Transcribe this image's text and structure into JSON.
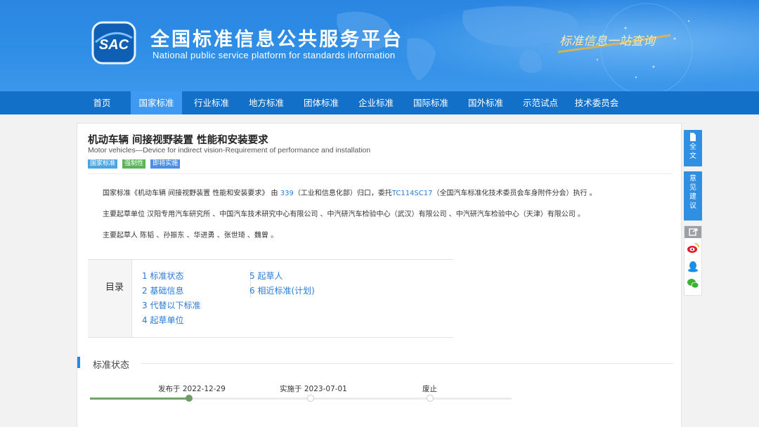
{
  "header": {
    "logo_text": "SAC",
    "title_cn": "全国标准信息公共服务平台",
    "title_en": "National public service platform  for standards information",
    "slogan": "标准信息一站查询"
  },
  "nav": {
    "items": [
      "首页",
      "国家标准",
      "行业标准",
      "地方标准",
      "团体标准",
      "企业标准",
      "国际标准",
      "国外标准",
      "示范试点",
      "技术委员会"
    ],
    "active": "国家标准"
  },
  "standard": {
    "title_cn": "机动车辆 间接视野装置 性能和安装要求",
    "title_en": "Motor vehicles—Device for indirect vision-Requirement of performance and installation",
    "tags": [
      "国家标准",
      "强制性",
      "即将实施"
    ]
  },
  "info": {
    "line1_prefix": "国家标准《机动车辆 间接视野装置 性能和安装要求》 由",
    "line1_link1": "339",
    "line1_mid": "（工业和信息化部）归口，委托",
    "line1_link2": "TC114SC17",
    "line1_suffix": "（全国汽车标准化技术委员会车身附件分会）执行 。",
    "line2": "主要起草单位 汉阳专用汽车研究所 、中国汽车技术研究中心有限公司 、中汽研汽车检验中心（武汉）有限公司 、中汽研汽车检验中心（天津）有限公司 。",
    "line3": "主要起草人 陈韬 、孙振东 、华进勇 、张世琦 、魏曾 。"
  },
  "toc": {
    "label": "目录",
    "items": [
      "1  标准状态",
      "2  基础信息",
      "3  代替以下标准",
      "4  起草单位",
      "5  起草人",
      "6  相近标准(计划)"
    ]
  },
  "status_section": {
    "title": "标准状态",
    "steps": [
      "发布于 2022-12-29",
      "实施于 2023-07-01",
      "废止"
    ],
    "completed_steps": 1
  },
  "sidebar": {
    "fulltext": "全文",
    "feedback": "意见建议"
  },
  "share": [
    "weibo-icon",
    "qq-icon",
    "wechat-icon"
  ],
  "colors": {
    "banner": "#2f8ee6",
    "nav": "#1270c9",
    "nav_active": "#3d9af0",
    "link": "#2a7bd8",
    "progress": "#72a36a"
  }
}
